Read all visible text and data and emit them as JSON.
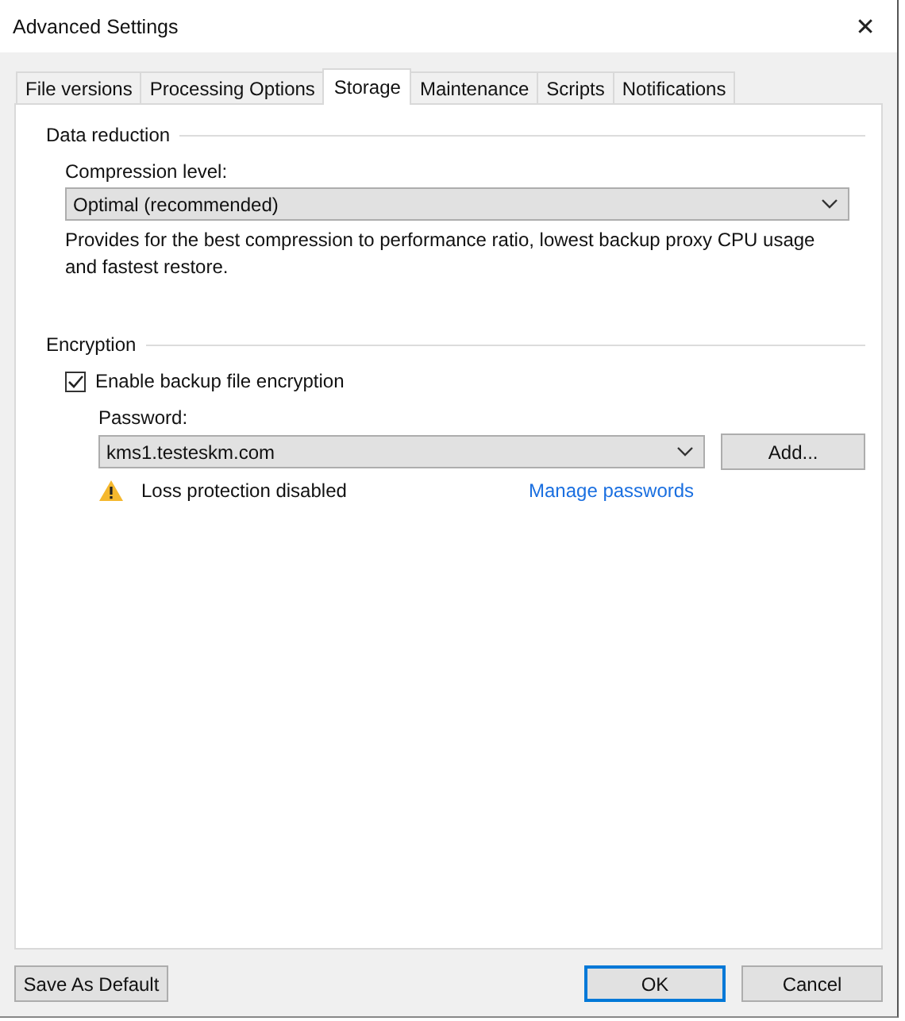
{
  "window": {
    "title": "Advanced Settings",
    "close": "✕"
  },
  "tabs": [
    {
      "label": "File versions",
      "selected": false
    },
    {
      "label": "Processing Options",
      "selected": false
    },
    {
      "label": "Storage",
      "selected": true
    },
    {
      "label": "Maintenance",
      "selected": false
    },
    {
      "label": "Scripts",
      "selected": false
    },
    {
      "label": "Notifications",
      "selected": false
    }
  ],
  "data_reduction": {
    "title": "Data reduction",
    "compression_label": "Compression level:",
    "compression_value": "Optimal (recommended)",
    "description": "Provides for the best compression to performance ratio, lowest backup proxy CPU usage and fastest restore."
  },
  "encryption": {
    "title": "Encryption",
    "enable_label": "Enable backup file encryption",
    "checked": true,
    "password_label": "Password:",
    "password_value": "kms1.testeskm.com",
    "add_button": "Add...",
    "warning": "Loss protection disabled",
    "manage_link": "Manage passwords"
  },
  "buttons": {
    "save_default": "Save As Default",
    "ok": "OK",
    "cancel": "Cancel"
  }
}
